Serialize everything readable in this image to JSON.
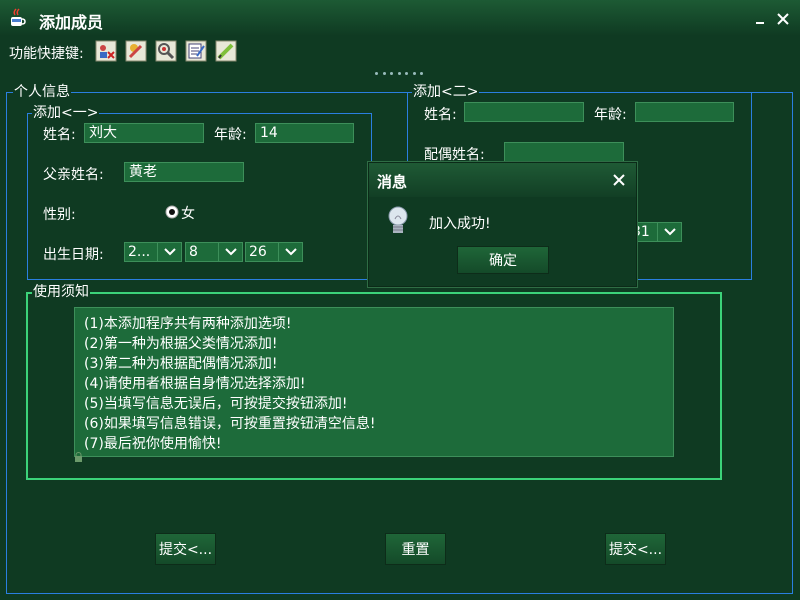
{
  "window": {
    "title": "添加成员"
  },
  "toolbar": {
    "label": "功能快捷键:",
    "buttons": [
      "member-manage-icon",
      "edit-member-icon",
      "search-icon",
      "notes-icon",
      "pencil-icon"
    ]
  },
  "personal_info": {
    "legend": "个人信息",
    "add_one": {
      "legend": "添加<一>",
      "name_label": "姓名:",
      "name_value": "刘大",
      "age_label": "年龄:",
      "age_value": "14",
      "father_label": "父亲姓名:",
      "father_value": "黄老",
      "gender_label": "性别:",
      "gender_option": "女",
      "birth_label": "出生日期:",
      "birth_year": "2...",
      "birth_month": "8",
      "birth_day": "26"
    },
    "add_two": {
      "legend": "添加<二>",
      "name_label": "姓名:",
      "name_value": "",
      "age_label": "年龄:",
      "age_value": "",
      "spouse_label": "配偶姓名:",
      "spouse_value": "",
      "date_partial": "31"
    }
  },
  "notes": {
    "legend": "使用须知",
    "lines": [
      "(1)本添加程序共有两种添加选项!",
      "(2)第一种为根据父类情况添加!",
      "(3)第二种为根据配偶情况添加!",
      "(4)请使用者根据自身情况选择添加!",
      "(5)当填写信息无误后，可按提交按钮添加!",
      "(6)如果填写信息错误，可按重置按钮清空信息!",
      "(7)最后祝你使用愉快!"
    ]
  },
  "buttons": {
    "submit_one": "提交<...",
    "reset": "重置",
    "submit_two": "提交<..."
  },
  "dialog": {
    "title": "消息",
    "message": "加入成功!",
    "ok": "确定"
  },
  "colors": {
    "background": "#0f3a22",
    "field": "#1d6b3a",
    "border_blue": "#2a7fe0",
    "border_green": "#3cd27a"
  }
}
